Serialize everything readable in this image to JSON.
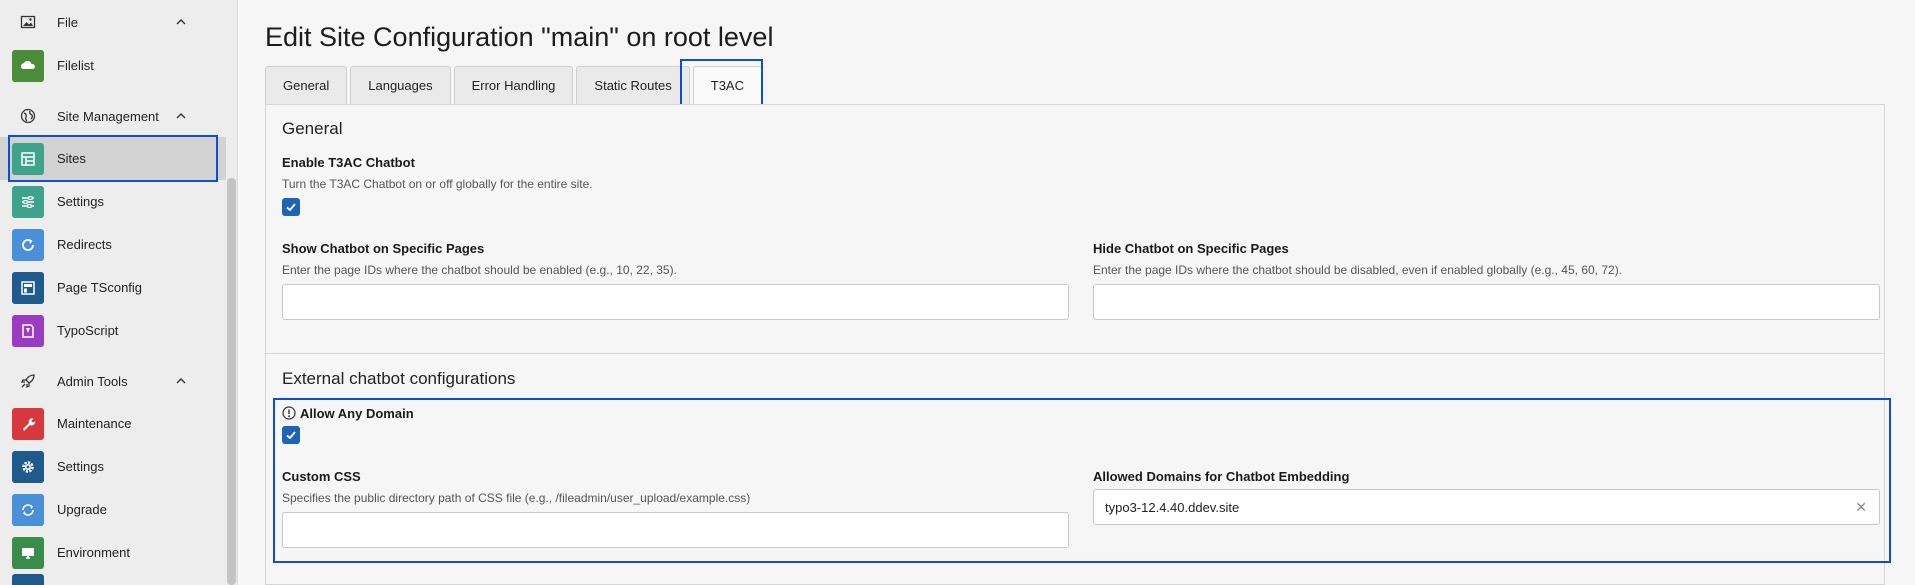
{
  "sidebar": {
    "groups": [
      {
        "label": "File",
        "icon": "image-icon"
      },
      {
        "label": "Site Management",
        "icon": "globe-icon"
      },
      {
        "label": "Admin Tools",
        "icon": "rocket-icon"
      }
    ],
    "items": [
      {
        "label": "Filelist",
        "color": "#4a8c3a",
        "icon": "cloud-folder-icon"
      },
      {
        "label": "Sites",
        "color": "#3fa28c",
        "icon": "sites-icon"
      },
      {
        "label": "Settings",
        "color": "#3fa28c",
        "icon": "sliders-icon"
      },
      {
        "label": "Redirects",
        "color": "#4a90d9",
        "icon": "refresh-icon"
      },
      {
        "label": "Page TSconfig",
        "color": "#1f5a8c",
        "icon": "page-icon"
      },
      {
        "label": "TypoScript",
        "color": "#9a3cc2",
        "icon": "typoscript-icon"
      },
      {
        "label": "Maintenance",
        "color": "#d6383e",
        "icon": "wrench-icon"
      },
      {
        "label": "Settings",
        "color": "#1f5a8c",
        "icon": "gear-icon"
      },
      {
        "label": "Upgrade",
        "color": "#4a90d9",
        "icon": "upgrade-icon"
      },
      {
        "label": "Environment",
        "color": "#3a8c4a",
        "icon": "monitor-icon"
      }
    ]
  },
  "main": {
    "title": "Edit Site Configuration \"main\" on root level",
    "tabs": [
      "General",
      "Languages",
      "Error Handling",
      "Static Routes",
      "T3AC"
    ],
    "active_tab": "T3AC",
    "general": {
      "heading": "General",
      "enable_label": "Enable T3AC Chatbot",
      "enable_desc": "Turn the T3AC Chatbot on or off globally for the entire site.",
      "enable_checked": true,
      "show_label": "Show Chatbot on Specific Pages",
      "show_desc": "Enter the page IDs where the chatbot should be enabled (e.g., 10, 22, 35).",
      "show_value": "",
      "hide_label": "Hide Chatbot on Specific Pages",
      "hide_desc": "Enter the page IDs where the chatbot should be disabled, even if enabled globally (e.g., 45, 60, 72).",
      "hide_value": ""
    },
    "external": {
      "heading": "External chatbot configurations",
      "allow_label": "Allow Any Domain",
      "allow_checked": true,
      "css_label": "Custom CSS",
      "css_desc": "Specifies the public directory path of CSS file (e.g., /fileadmin/user_upload/example.css)",
      "css_value": "",
      "domains_label": "Allowed Domains for Chatbot Embedding",
      "domains_value": "typo3-12.4.40.ddev.site"
    }
  },
  "colors": {
    "highlight": "#0b4fd6",
    "checkbox": "#1e63b5"
  }
}
